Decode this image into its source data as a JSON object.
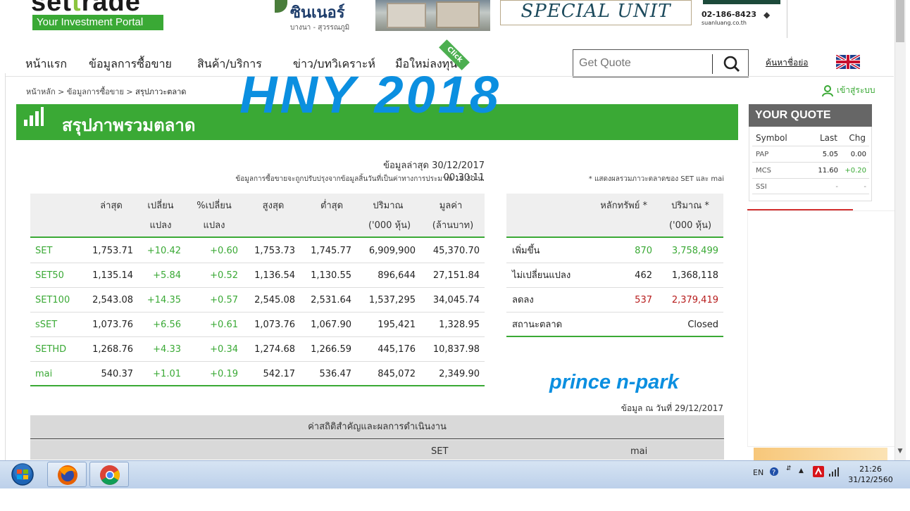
{
  "header": {
    "logo_main": "settrade",
    "logo_tagline": "Your Investment Portal",
    "ad_brand_name": "ซินเนอร์",
    "ad_brand_sub": "บางนา - สุวรรณภูมิ",
    "ad_special": "SPECIAL UNIT",
    "ad_phone": "02-186-8423",
    "ad_web": "suanluang.co.th"
  },
  "nav": {
    "items": [
      "หน้าแรก",
      "ข้อมูลการซื้อขาย",
      "สินค้า/บริการ",
      "ข่าว/บทวิเคราะห์",
      "มือใหม่ลงทุน"
    ],
    "click_tag": "Click",
    "quote_placeholder": "Get Quote",
    "abbr_link": "ค้นหาชื่อย่อ",
    "lang_flag": "uk-flag-icon"
  },
  "breadcrumb": {
    "home": "หน้าหลัก",
    "sep": " > ",
    "parent": "ข้อมูลการซื้อขาย",
    "current": "สรุปภาวะตลาด"
  },
  "login_label": "เข้าสู่ระบบ",
  "overlay_hny": "HNY   2018",
  "overlay_prince": "prince n-park",
  "section_title": "สรุปภาพรวมตลาด",
  "updated": "ข้อมูลล่าสุด 30/12/2017 00:30:11",
  "note_left": "ข้อมูลการซื้อขายจะถูกปรับปรุงจากข้อมูลสิ้นวันที่เป็นค่าทางการประมาณ 18:30 น.",
  "note_right": "* แสดงผลรวมภาวะตลาดของ SET และ mai",
  "index_table": {
    "headers": {
      "last": "ล่าสุด",
      "chg1": "เปลี่ยน",
      "chg2": "แปลง",
      "pchg1": "%เปลี่ยน",
      "pchg2": "แปลง",
      "high": "สูงสุด",
      "low": "ต่ำสุด",
      "vol1": "ปริมาณ",
      "vol2": "('000 หุ้น)",
      "val1": "มูลค่า",
      "val2": "(ล้านบาท)"
    },
    "rows": [
      {
        "name": "SET",
        "last": "1,753.71",
        "chg": "+10.42",
        "pchg": "+0.60",
        "high": "1,753.73",
        "low": "1,745.77",
        "vol": "6,909,900",
        "val": "45,370.70"
      },
      {
        "name": "SET50",
        "last": "1,135.14",
        "chg": "+5.84",
        "pchg": "+0.52",
        "high": "1,136.54",
        "low": "1,130.55",
        "vol": "896,644",
        "val": "27,151.84"
      },
      {
        "name": "SET100",
        "last": "2,543.08",
        "chg": "+14.35",
        "pchg": "+0.57",
        "high": "2,545.08",
        "low": "2,531.64",
        "vol": "1,537,295",
        "val": "34,045.74"
      },
      {
        "name": "sSET",
        "last": "1,073.76",
        "chg": "+6.56",
        "pchg": "+0.61",
        "high": "1,073.76",
        "low": "1,067.90",
        "vol": "195,421",
        "val": "1,328.95"
      },
      {
        "name": "SETHD",
        "last": "1,268.76",
        "chg": "+4.33",
        "pchg": "+0.34",
        "high": "1,274.68",
        "low": "1,266.59",
        "vol": "445,176",
        "val": "10,837.98"
      },
      {
        "name": "mai",
        "last": "540.37",
        "chg": "+1.01",
        "pchg": "+0.19",
        "high": "542.17",
        "low": "536.47",
        "vol": "845,072",
        "val": "2,349.90"
      }
    ]
  },
  "breadth_table": {
    "headers": {
      "sec": "หลักทรัพย์ *",
      "vol1": "ปริมาณ *",
      "vol2": "('000 หุ้น)"
    },
    "rows": [
      {
        "label": "เพิ่มขึ้น",
        "count": "870",
        "vol": "3,758,499"
      },
      {
        "label": "ไม่เปลี่ยนแปลง",
        "count": "462",
        "vol": "1,368,118"
      },
      {
        "label": "ลดลง",
        "count": "537",
        "vol": "2,379,419"
      },
      {
        "label": "สถานะตลาด",
        "count": "",
        "vol": "Closed"
      }
    ]
  },
  "as_of": "ข้อมูล ณ วันที่ 29/12/2017",
  "stats": {
    "title": "ค่าสถิติสำคัญและผลการดำเนินงาน",
    "col_set": "SET",
    "col_mai": "mai"
  },
  "your_quote": {
    "title": "YOUR QUOTE",
    "headers": {
      "symbol": "Symbol",
      "last": "Last",
      "chg": "Chg"
    },
    "rows": [
      {
        "symbol": "PAP",
        "last": "5.05",
        "chg": "0.00"
      },
      {
        "symbol": "MCS",
        "last": "11.60",
        "chg": "+0.20"
      },
      {
        "symbol": "SSI",
        "last": "-",
        "chg": "-"
      }
    ]
  },
  "taskbar": {
    "lang": "EN",
    "time": "21:26",
    "date": "31/12/2560"
  },
  "colors": {
    "green": "#3aa935",
    "blue_overlay": "#0b8fe0",
    "red": "#b71c1c"
  }
}
